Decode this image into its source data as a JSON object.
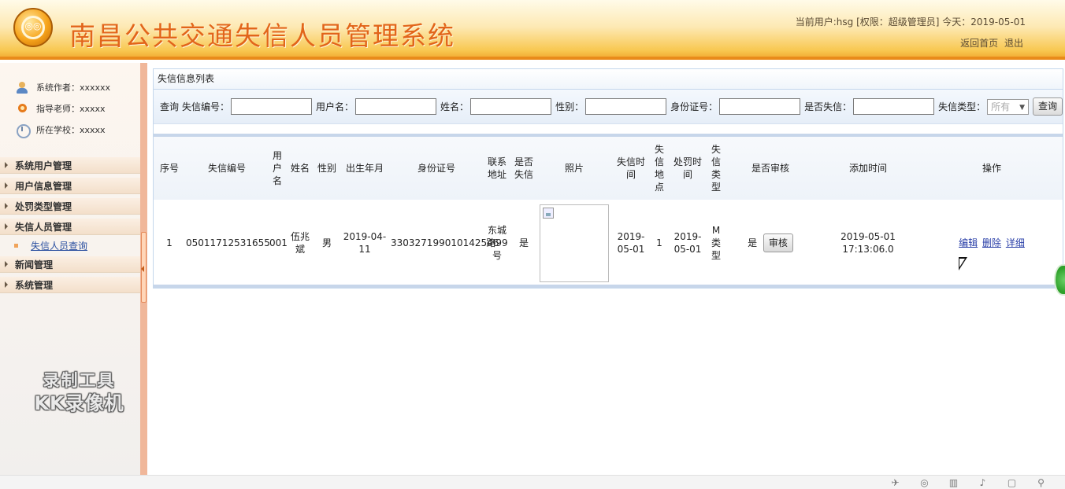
{
  "header": {
    "title": "南昌公共交通失信人员管理系统",
    "user_info": "当前用户:hsg [权限：超级管理员] 今天：2019-05-01",
    "link_home": "返回首页",
    "link_logout": "退出"
  },
  "sidebar": {
    "info": [
      {
        "label": "系统作者：xxxxxx",
        "icon": "user-icon"
      },
      {
        "label": "指导老师：xxxxx",
        "icon": "teacher-icon"
      },
      {
        "label": "所在学校：xxxxx",
        "icon": "school-icon"
      }
    ],
    "menu": [
      "系统用户管理",
      "用户信息管理",
      "处罚类型管理",
      "失信人员管理",
      "新闻管理",
      "系统管理"
    ],
    "submenu_active": "失信人员查询"
  },
  "watermark": {
    "line1": "录制工具",
    "line2": "KK录像机"
  },
  "panel": {
    "title": "失信信息列表",
    "search": {
      "prefix": "查询",
      "fields": [
        "失信编号：",
        "用户名：",
        "姓名：",
        "性别：",
        "身份证号：",
        "是否失信："
      ],
      "type_label": "失信类型：",
      "type_value": "所有",
      "button": "查询"
    },
    "table": {
      "headers": [
        "序号",
        "失信编号",
        "用户名",
        "姓名",
        "性别",
        "出生年月",
        "身份证号",
        "联系地址",
        "是否失信",
        "照片",
        "失信时间",
        "失信地点",
        "处罚时间",
        "失信类型",
        "是否审核",
        "添加时间",
        "操作"
      ],
      "rows": [
        {
          "index": "1",
          "code": "05011712531655",
          "username": "001",
          "name": "伍兆斌",
          "gender": "男",
          "birth": "2019-04-11",
          "id_card": "330327199010142546",
          "address": "东城路99号",
          "is_dishonest": "是",
          "dishonest_time": "2019-05-01",
          "place": "1",
          "punish_time": "2019-05-01",
          "type": "M类型",
          "audited": "是",
          "audit_button": "审核",
          "added_time": "2019-05-01 17:13:06.0",
          "ops": [
            "编辑",
            "删除",
            "详细"
          ]
        }
      ]
    }
  },
  "colors": {
    "title": "#e2651a",
    "header_bottom": "#e98b1a",
    "link": "#2a3fa8",
    "table_rule": "#c7d6ea"
  }
}
